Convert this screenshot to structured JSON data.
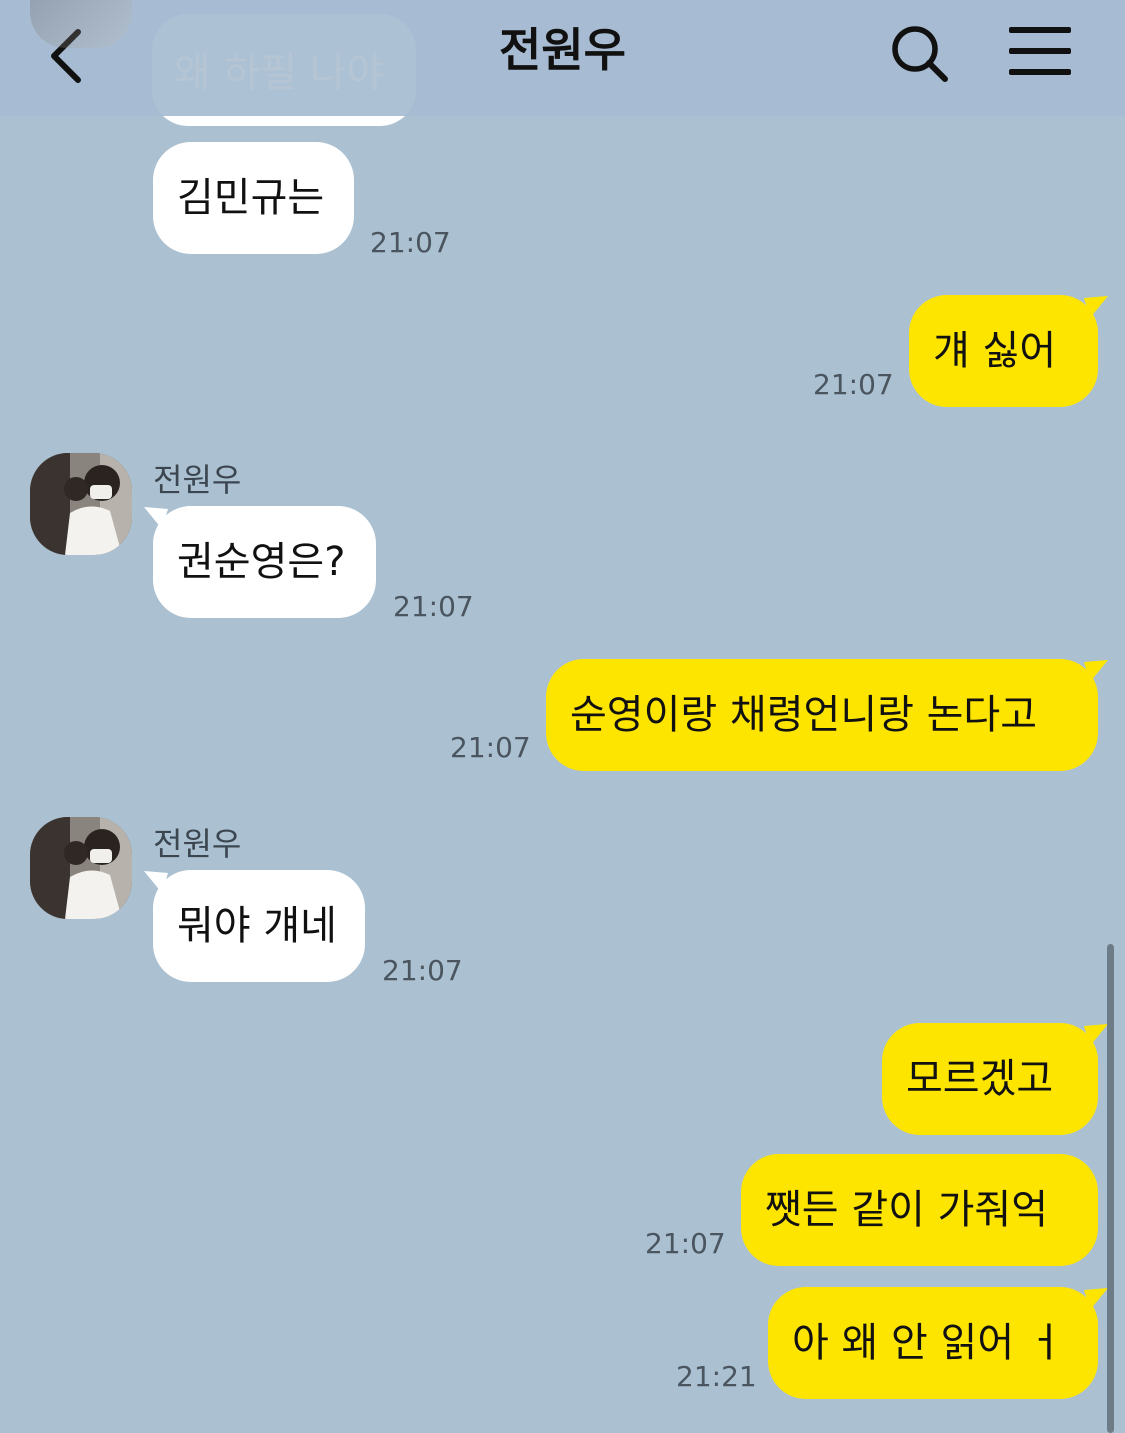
{
  "header": {
    "title": "전원우",
    "back_icon": "chevron-left-icon",
    "search_icon": "search-icon",
    "menu_icon": "hamburger-menu-icon"
  },
  "colors": {
    "background": "#abc1d1",
    "incoming_bubble": "#ffffff",
    "outgoing_bubble": "#fee500"
  },
  "messages": {
    "ghost": {
      "text": "왜 하필 나야"
    },
    "m1": {
      "text": "김민규는",
      "time": "21:07"
    },
    "m2": {
      "text": "걔 싫어",
      "time": "21:07"
    },
    "m3": {
      "sender": "전원우",
      "text": "권순영은?",
      "time": "21:07"
    },
    "m4": {
      "text": "순영이랑 채령언니랑 논다고",
      "time": "21:07"
    },
    "m5": {
      "sender": "전원우",
      "text": "뭐야 걔네",
      "time": "21:07"
    },
    "m6": {
      "text": "모르겠고"
    },
    "m7": {
      "text": "쨋든 같이 가줘억",
      "time": "21:07"
    },
    "m8": {
      "text": "아 왜 안 읽어 ㅓ",
      "time": "21:21"
    }
  }
}
